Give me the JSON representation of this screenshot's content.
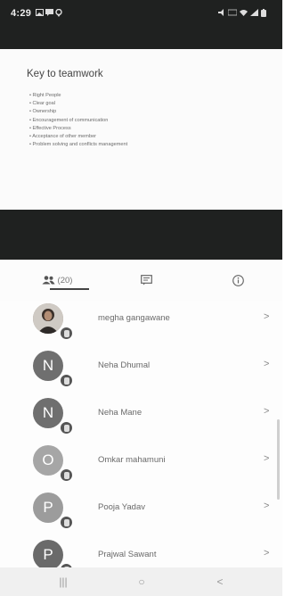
{
  "status_bar": {
    "time": "4:29",
    "left_icons": [
      "gallery-icon",
      "message-icon",
      "location-icon"
    ],
    "right_icons": [
      "mute-icon",
      "lte-icon",
      "wifi-icon",
      "signal-icon",
      "battery-icon"
    ]
  },
  "slide": {
    "title": "Key to teamwork",
    "bullets": [
      "Right People",
      "Clear goal",
      "Ownership",
      "Encouragement of communication",
      "Effective Process",
      "Acceptance of other member",
      "Problem solving and conflicts management"
    ]
  },
  "tabs": {
    "participants_count": "(20)",
    "items": [
      {
        "icon": "people-icon"
      },
      {
        "icon": "chat-icon"
      },
      {
        "icon": "info-icon"
      }
    ],
    "active": 0
  },
  "participants": [
    {
      "initial": "",
      "name": "megha gangawane",
      "avatar_color": "#8a7d70",
      "photo": true
    },
    {
      "initial": "N",
      "name": "Neha Dhumal",
      "avatar_color": "#6f6f6f",
      "photo": false
    },
    {
      "initial": "N",
      "name": "Neha Mane",
      "avatar_color": "#6f6f6f",
      "photo": false
    },
    {
      "initial": "O",
      "name": "Omkar mahamuni",
      "avatar_color": "#a6a6a6",
      "photo": false
    },
    {
      "initial": "P",
      "name": "Pooja Yadav",
      "avatar_color": "#9c9c9c",
      "photo": false
    },
    {
      "initial": "P",
      "name": "Prajwal Sawant",
      "avatar_color": "#6a6a6a",
      "photo": false
    }
  ],
  "row_chevron": ">",
  "nav": {
    "recents": "|||",
    "home": "○",
    "back": "<"
  }
}
